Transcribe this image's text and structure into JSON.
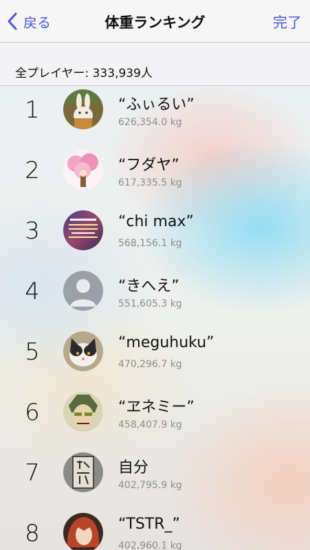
{
  "nav": {
    "back_label": "戻る",
    "title": "体重ランキング",
    "done_label": "完了",
    "accent_color": "#4a57d8"
  },
  "summary": {
    "total_players": "全プレイヤー: 333,939人"
  },
  "rankings": [
    {
      "rank": "1",
      "name": "“ふぃるい”",
      "weight": "626,354.0 kg",
      "avatar_icon": "rabbit-avatar-icon"
    },
    {
      "rank": "2",
      "name": "“フダヤ”",
      "weight": "617,335.5 kg",
      "avatar_icon": "cherry-tree-avatar-icon"
    },
    {
      "rank": "3",
      "name": "“chi max”",
      "weight": "568,156.1 kg",
      "avatar_icon": "text-poster-avatar-icon"
    },
    {
      "rank": "4",
      "name": "“きへえ”",
      "weight": "551,605.3 kg",
      "avatar_icon": "default-person-avatar-icon"
    },
    {
      "rank": "5",
      "name": "“meguhuku”",
      "weight": "470,296.7 kg",
      "avatar_icon": "cat-avatar-icon"
    },
    {
      "rank": "6",
      "name": "“ヱネミー”",
      "weight": "458,407.9 kg",
      "avatar_icon": "anime-face-avatar-icon"
    },
    {
      "rank": "7",
      "name": "自分",
      "weight": "402,795.9 kg",
      "avatar_icon": "kanji-sign-avatar-icon"
    },
    {
      "rank": "8",
      "name": "“TSTR_”",
      "weight": "402,960.1 kg",
      "avatar_icon": "red-hair-avatar-icon"
    }
  ]
}
